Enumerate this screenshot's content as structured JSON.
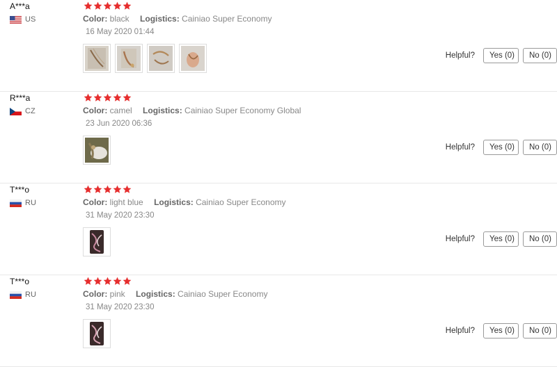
{
  "accent_star_color": "#e62e2e",
  "helpful_label": "Helpful?",
  "labels": {
    "color": "Color:",
    "logistics": "Logistics:"
  },
  "reviews": [
    {
      "user": "A***a",
      "country": "US",
      "flag_icon": "us-flag-icon",
      "rating": 5,
      "color": "black",
      "logistics": "Cainiao Super Economy",
      "date": "16 May 2020 01:44",
      "photos": [
        "necklace-photo",
        "necklace-photo",
        "necklace-photo",
        "hand-with-necklace-photo"
      ],
      "yes": "Yes (0)",
      "no": "No (0)"
    },
    {
      "user": "R***a",
      "country": "CZ",
      "flag_icon": "cz-flag-icon",
      "rating": 5,
      "color": "camel",
      "logistics": "Cainiao Super Economy Global",
      "date": "23 Jun 2020 06:36",
      "photos": [
        "product-photo"
      ],
      "yes": "Yes (0)",
      "no": "No (0)"
    },
    {
      "user": "T***o",
      "country": "RU",
      "flag_icon": "ru-flag-icon",
      "rating": 5,
      "color": "light blue",
      "logistics": "Cainiao Super Economy",
      "date": "31 May 2020 23:30",
      "photos": [
        "product-photo"
      ],
      "yes": "Yes (0)",
      "no": "No (0)"
    },
    {
      "user": "T***o",
      "country": "RU",
      "flag_icon": "ru-flag-icon",
      "rating": 5,
      "color": "pink",
      "logistics": "Cainiao Super Economy",
      "date": "31 May 2020 23:30",
      "photos": [
        "product-photo"
      ],
      "yes": "Yes (0)",
      "no": "No (0)"
    }
  ]
}
